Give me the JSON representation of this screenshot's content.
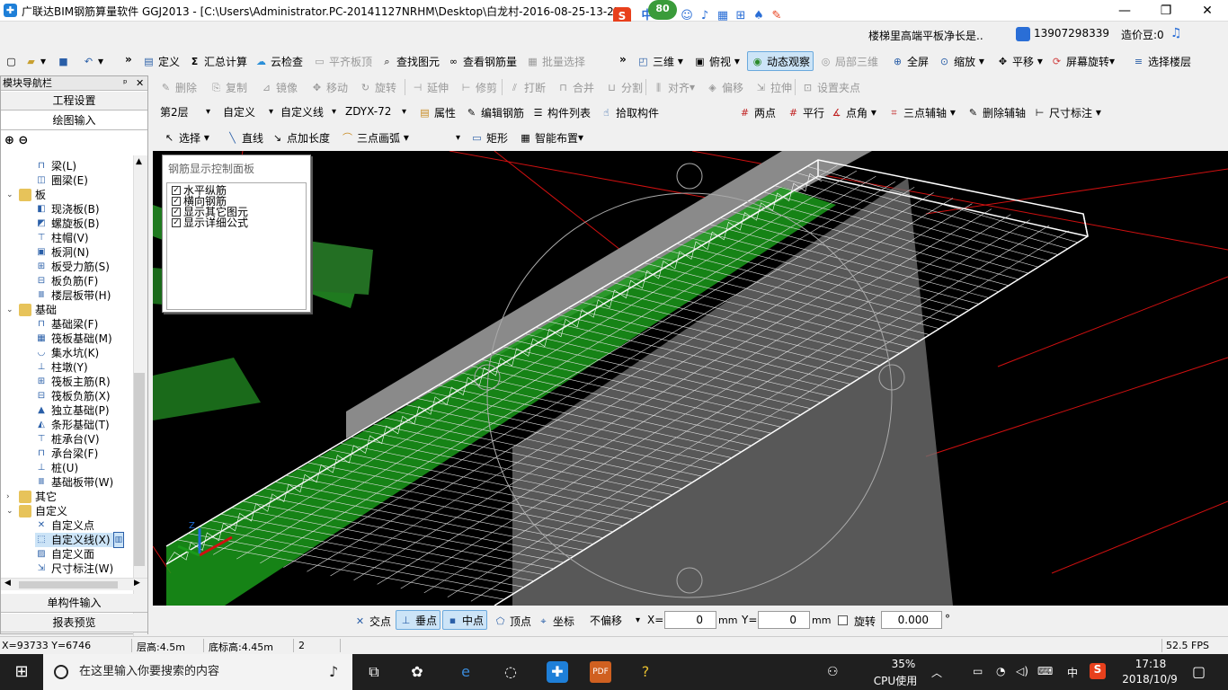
{
  "window": {
    "title": "广联达BIM钢筋算量软件 GGJ2013 - [C:\\Users\\Administrator.PC-20141127NRHM\\Desktop\\白龙村-2016-08-25-13-27",
    "min": "—",
    "max": "❐",
    "close": "✕"
  },
  "ime": {
    "badge": "80",
    "s": "S",
    "lang": "中"
  },
  "menubar": {
    "notice": "楼梯里高端平板净长是..",
    "phone": "13907298339",
    "points": "造价豆:0"
  },
  "toolbar1": {
    "define": "定义",
    "sum": "汇总计算",
    "cloud_check": "云检查",
    "align_top": "平齐板顶",
    "find": "查找图元",
    "view_rebar": "查看钢筋量",
    "batch_select": "批量选择",
    "three_d": "三维",
    "top_view": "俯视",
    "dynamic_view": "动态观察",
    "local_3d": "局部三维",
    "fullscreen": "全屏",
    "zoom": "缩放",
    "pan": "平移",
    "rotate_screen": "屏幕旋转",
    "select_floor": "选择楼层"
  },
  "toolbar2": {
    "delete": "删除",
    "copy": "复制",
    "mirror": "镜像",
    "move": "移动",
    "rotate": "旋转",
    "extend": "延伸",
    "trim": "修剪",
    "break": "打断",
    "merge": "合并",
    "split": "分割",
    "align": "对齐",
    "offset": "偏移",
    "stretch": "拉伸",
    "set_grip": "设置夹点"
  },
  "toolbar3": {
    "floor": "第2层",
    "category": "自定义",
    "type": "自定义线",
    "component": "ZDYX-72",
    "properties": "属性",
    "edit_rebar": "编辑钢筋",
    "component_list": "构件列表",
    "pick": "拾取构件",
    "two_points": "两点",
    "parallel": "平行",
    "point_angle": "点角",
    "three_point_axis": "三点辅轴",
    "delete_axis": "删除辅轴",
    "dimension": "尺寸标注"
  },
  "toolbar4": {
    "select": "选择",
    "line": "直线",
    "point_length": "点加长度",
    "three_point_arc": "三点画弧",
    "rect": "矩形",
    "smart_place": "智能布置"
  },
  "nav": {
    "header": "模块导航栏",
    "pin": "ᵖ",
    "close": "✕",
    "tab_project": "工程设置",
    "tab_draw": "绘图输入",
    "tab_single": "单构件输入",
    "tab_report": "报表预览",
    "tree": [
      {
        "label": "梁(L)",
        "level": 2,
        "icon": "beam-icon"
      },
      {
        "label": "圈梁(E)",
        "level": 2,
        "icon": "ring-beam-icon"
      },
      {
        "label": "板",
        "level": 1,
        "folder": true,
        "expand": "⌄"
      },
      {
        "label": "现浇板(B)",
        "level": 2,
        "icon": "slab-icon"
      },
      {
        "label": "螺旋板(B)",
        "level": 2,
        "icon": "spiral-slab-icon"
      },
      {
        "label": "柱帽(V)",
        "level": 2,
        "icon": "column-cap-icon"
      },
      {
        "label": "板洞(N)",
        "level": 2,
        "icon": "slab-hole-icon"
      },
      {
        "label": "板受力筋(S)",
        "level": 2,
        "icon": "slab-rebar-icon"
      },
      {
        "label": "板负筋(F)",
        "level": 2,
        "icon": "slab-neg-rebar-icon"
      },
      {
        "label": "楼层板带(H)",
        "level": 2,
        "icon": "floor-band-icon"
      },
      {
        "label": "基础",
        "level": 1,
        "folder": true,
        "expand": "⌄"
      },
      {
        "label": "基础梁(F)",
        "level": 2,
        "icon": "foundation-beam-icon"
      },
      {
        "label": "筏板基础(M)",
        "level": 2,
        "icon": "raft-icon"
      },
      {
        "label": "集水坑(K)",
        "level": 2,
        "icon": "sump-icon"
      },
      {
        "label": "柱墩(Y)",
        "level": 2,
        "icon": "pier-icon"
      },
      {
        "label": "筏板主筋(R)",
        "level": 2,
        "icon": "raft-main-rebar-icon"
      },
      {
        "label": "筏板负筋(X)",
        "level": 2,
        "icon": "raft-neg-rebar-icon"
      },
      {
        "label": "独立基础(P)",
        "level": 2,
        "icon": "isolated-footing-icon"
      },
      {
        "label": "条形基础(T)",
        "level": 2,
        "icon": "strip-footing-icon"
      },
      {
        "label": "桩承台(V)",
        "level": 2,
        "icon": "pile-cap-icon"
      },
      {
        "label": "承台梁(F)",
        "level": 2,
        "icon": "cap-beam-icon"
      },
      {
        "label": "桩(U)",
        "level": 2,
        "icon": "pile-icon"
      },
      {
        "label": "基础板带(W)",
        "level": 2,
        "icon": "foundation-band-icon"
      },
      {
        "label": "其它",
        "level": 1,
        "folder": true,
        "expand": "›"
      },
      {
        "label": "自定义",
        "level": 1,
        "folder": true,
        "expand": "⌄"
      },
      {
        "label": "自定义点",
        "level": 2,
        "icon": "custom-point-icon"
      },
      {
        "label": "自定义线(X)",
        "level": 2,
        "icon": "custom-line-icon",
        "selected": true
      },
      {
        "label": "自定义面",
        "level": 2,
        "icon": "custom-face-icon"
      },
      {
        "label": "尺寸标注(W)",
        "level": 2,
        "icon": "dimension-icon"
      }
    ]
  },
  "panel": {
    "title": "钢筋显示控制面板",
    "items": [
      "水平纵筋",
      "横向钢筋",
      "显示其它图元",
      "显示详细公式"
    ],
    "check": "✓"
  },
  "snapbar": {
    "intersect": "交点",
    "perpendicular": "垂点",
    "midpoint": "中点",
    "vertex": "顶点",
    "coord": "坐标",
    "offset_mode": "不偏移",
    "x_label": "X=",
    "x_value": "0",
    "mm1": "mm",
    "y_label": "Y=",
    "y_value": "0",
    "mm2": "mm",
    "rotate_label": "旋转",
    "rotate_value": "0.000",
    "degree": "°"
  },
  "status": {
    "coords": "X=93733 Y=6746",
    "floor_height": "层高:4.5m",
    "bottom_height": "底标高:4.45m",
    "count": "2",
    "fps": "52.5 FPS"
  },
  "taskbar": {
    "search_placeholder": "在这里输入你要搜索的内容",
    "cpu_pct": "35%",
    "cpu_label": "CPU使用",
    "lang": "中",
    "time": "17:18",
    "date": "2018/10/9"
  },
  "colors": {
    "viewport_bg": "#000000",
    "beam_green": "#1a8f1a",
    "slab_gray": "#8a8a8a",
    "rebar_white": "#ffffff",
    "grid_red": "#d01010"
  }
}
